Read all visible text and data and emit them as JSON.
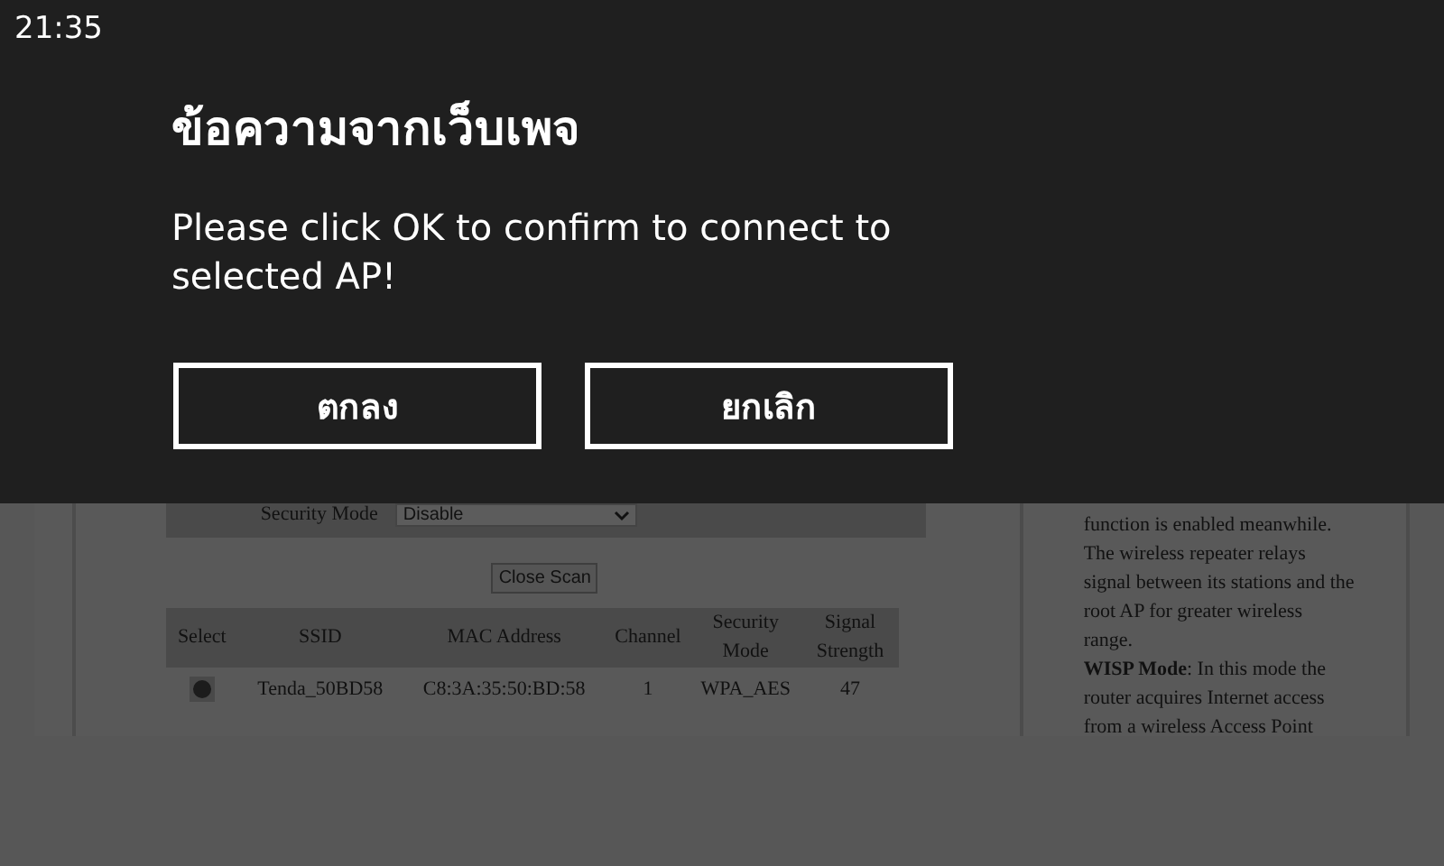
{
  "status_bar": {
    "time": "21:35"
  },
  "dialog": {
    "title": "ข้อความจากเว็บเพจ",
    "message": "Please click OK to confirm to connect to selected AP!",
    "buttons": [
      "ตกลง",
      "ยกเลิก"
    ]
  },
  "page": {
    "security_mode": {
      "label": "Security Mode",
      "value": "Disable"
    },
    "close_scan": "Close Scan",
    "table": {
      "columns": [
        "Select",
        "SSID",
        "MAC Address",
        "Channel",
        "Security Mode",
        "Signal Strength"
      ],
      "rows": [
        {
          "selected": true,
          "cells": [
            "",
            "Tenda_50BD58",
            "C8:3A:35:50:BD:58",
            "1",
            "WPA_AES",
            "47"
          ]
        }
      ]
    },
    "help": [
      "function is enabled meanwhile. The wireless repeater relays signal between its stations and the root AP for greater wireless range.",
      "**WISP Mode**: In this mode the router acquires Internet access from a wireless Access Point"
    ]
  }
}
